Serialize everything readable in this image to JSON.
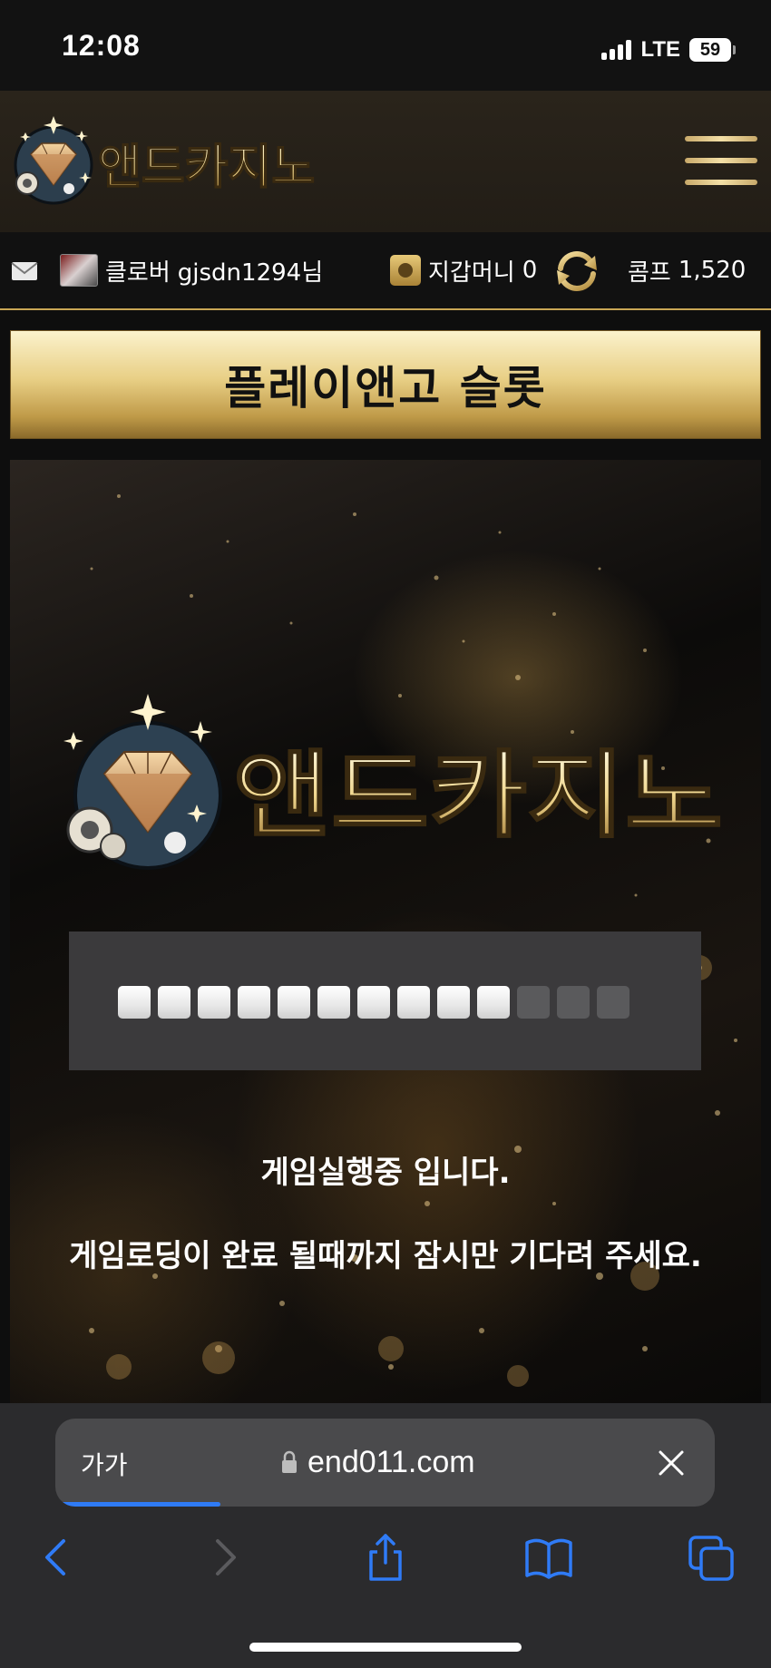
{
  "status_bar": {
    "time": "12:08",
    "network": "LTE",
    "battery": "59"
  },
  "header": {
    "logo_text": "앤드카지노",
    "menu_icon": "hamburger-icon"
  },
  "user_bar": {
    "level": "클로버",
    "username": "gjsdn1294님",
    "wallet_label": "지갑머니",
    "wallet_amount": "0",
    "comp_label": "콤프",
    "comp_amount": "1,520"
  },
  "game": {
    "title": "플레이앤고 슬롯",
    "logo_text": "앤드카지노",
    "progress_blocks_total": 13,
    "progress_blocks_filled": 10,
    "message_1": "게임실행중 입니다.",
    "message_2": "게임로딩이 완료 될때까지 잠시만 기다려 주세요."
  },
  "browser": {
    "aa_label": "가가",
    "url": "end011.com",
    "load_progress": 0.25
  },
  "colors": {
    "gold": "#d9bb6a",
    "gold_light": "#f7e7b0",
    "ios_blue": "#2f7bf6"
  }
}
